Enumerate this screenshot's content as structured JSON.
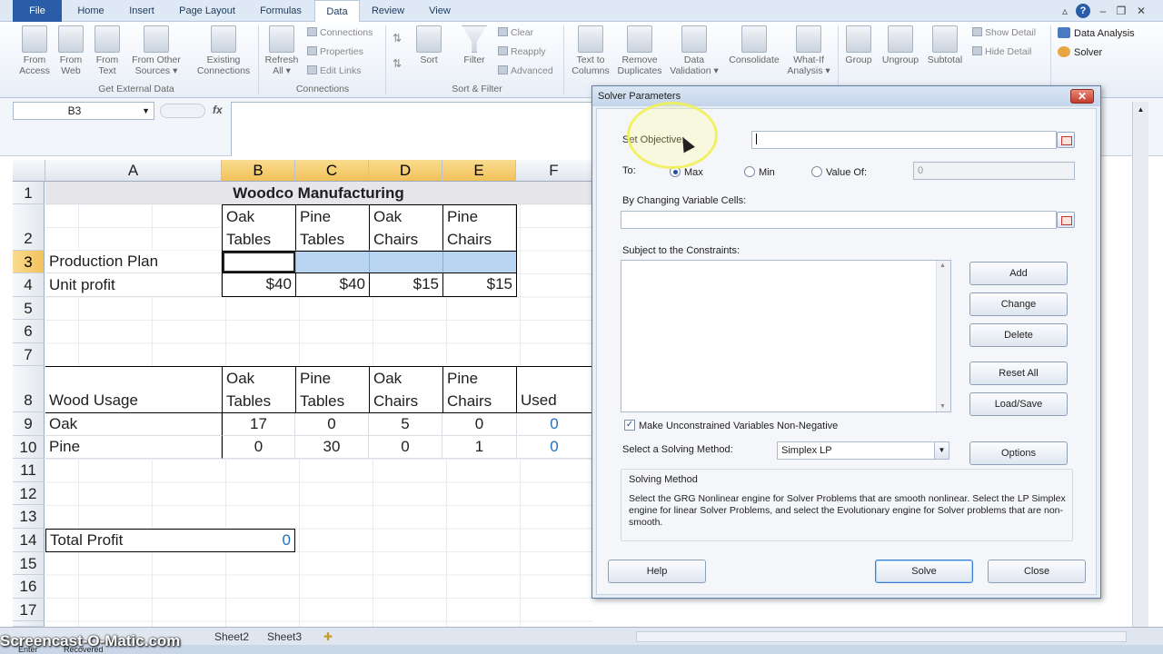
{
  "tabs": [
    "File",
    "Home",
    "Insert",
    "Page Layout",
    "Formulas",
    "Data",
    "Review",
    "View"
  ],
  "active_tab": "Data",
  "ribbon": {
    "get_external": {
      "buttons": [
        {
          "l1": "From",
          "l2": "Access"
        },
        {
          "l1": "From",
          "l2": "Web"
        },
        {
          "l1": "From",
          "l2": "Text"
        },
        {
          "l1": "From Other",
          "l2": "Sources ▾"
        },
        {
          "l1": "Existing",
          "l2": "Connections"
        }
      ],
      "label": "Get External Data"
    },
    "connections": {
      "refresh": {
        "l1": "Refresh",
        "l2": "All ▾"
      },
      "items": [
        "Connections",
        "Properties",
        "Edit Links"
      ],
      "label": "Connections"
    },
    "sort_filter": {
      "sort": "Sort",
      "filter": "Filter",
      "items": [
        "Clear",
        "Reapply",
        "Advanced"
      ],
      "label": "Sort & Filter"
    },
    "data_tools": {
      "buttons": [
        {
          "l1": "Text to",
          "l2": "Columns"
        },
        {
          "l1": "Remove",
          "l2": "Duplicates"
        },
        {
          "l1": "Data",
          "l2": "Validation ▾"
        },
        {
          "l1": "Consolidate",
          "l2": ""
        },
        {
          "l1": "What-If",
          "l2": "Analysis ▾"
        }
      ]
    },
    "outline": {
      "buttons": [
        "Group",
        "Ungroup",
        "Subtotal"
      ],
      "items": [
        "Show Detail",
        "Hide Detail"
      ]
    },
    "analysis": {
      "items": [
        "Data Analysis",
        "Solver"
      ]
    }
  },
  "name_box": "B3",
  "fx": "fx",
  "columns": [
    "A",
    "B",
    "C",
    "D",
    "E",
    "F"
  ],
  "sheet": {
    "title": "Woodco Manufacturing",
    "hdr1": [
      [
        "Oak",
        "Tables"
      ],
      [
        "Pine",
        "Tables"
      ],
      [
        "Oak",
        "Chairs"
      ],
      [
        "Pine",
        "Chairs"
      ]
    ],
    "production_plan": "Production Plan",
    "unit_profit_label": "Unit profit",
    "unit_profit": [
      "$40",
      "$40",
      "$15",
      "$15"
    ],
    "wood_usage": "Wood Usage",
    "used": "Used",
    "oak_label": "Oak",
    "oak": [
      "17",
      "0",
      "5",
      "0"
    ],
    "oak_used": "0",
    "pine_label": "Pine",
    "pine": [
      "0",
      "30",
      "0",
      "1"
    ],
    "pine_used": "0",
    "total_profit_label": "Total Profit",
    "total_profit": "0"
  },
  "sheet_tabs": [
    "Sheet2",
    "Sheet3"
  ],
  "watermark": "Screencast-O-Matic.com",
  "status": {
    "left1": "Enter",
    "left2": "Recovered"
  },
  "dialog": {
    "title": "Solver Parameters",
    "set_objective": "Set Objective:",
    "objective_value": "",
    "to": "To:",
    "max": "Max",
    "min": "Min",
    "value_of": "Value Of:",
    "value_of_value": "0",
    "changing_cells": "By Changing Variable Cells:",
    "constraints": "Subject to the Constraints:",
    "btn_add": "Add",
    "btn_change": "Change",
    "btn_delete": "Delete",
    "btn_reset": "Reset All",
    "btn_load": "Load/Save",
    "nonneg": "Make Unconstrained Variables Non-Negative",
    "method_label": "Select a Solving Method:",
    "method_value": "Simplex LP",
    "btn_options": "Options",
    "sm_title": "Solving Method",
    "sm_text": "Select the GRG Nonlinear engine for Solver Problems that are smooth nonlinear. Select the LP Simplex engine for linear Solver Problems, and select the Evolutionary engine for Solver problems that are non-smooth.",
    "btn_help": "Help",
    "btn_solve": "Solve",
    "btn_close": "Close"
  }
}
